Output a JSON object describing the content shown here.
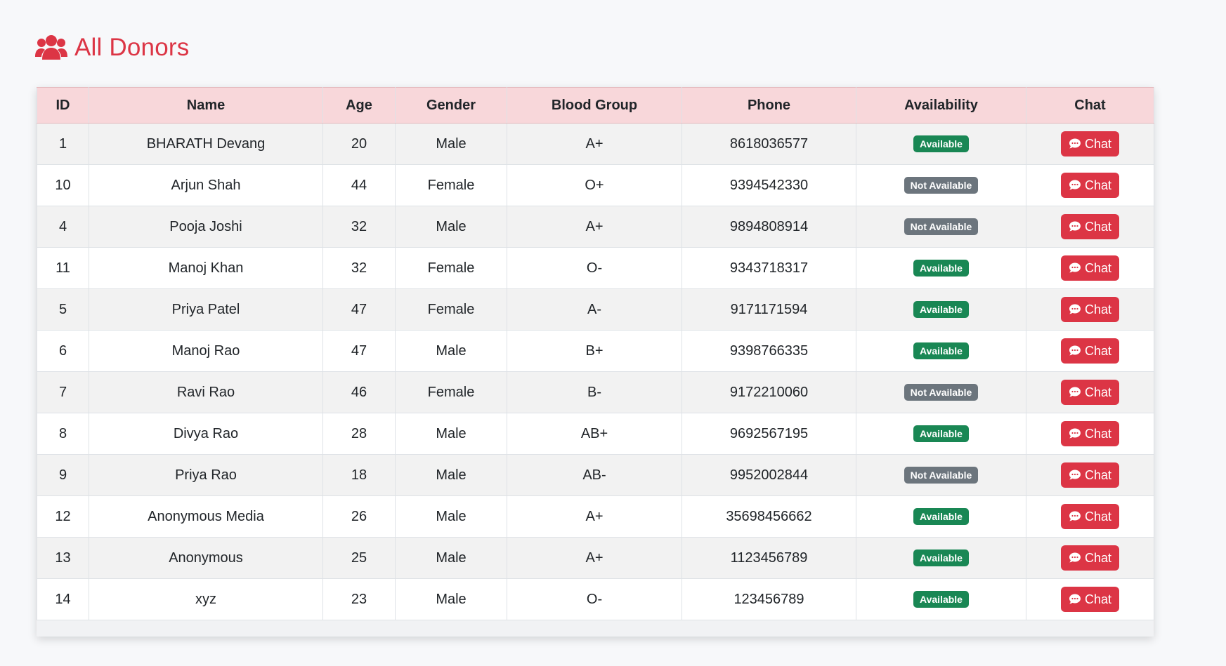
{
  "header": {
    "title": "All Donors",
    "icon": "users-icon",
    "accent_color": "#dc3545"
  },
  "table": {
    "columns": [
      "ID",
      "Name",
      "Age",
      "Gender",
      "Blood Group",
      "Phone",
      "Availability",
      "Chat"
    ],
    "rows": [
      {
        "id": "1",
        "name": "BHARATH Devang",
        "age": "20",
        "gender": "Male",
        "blood_group": "A+",
        "phone": "8618036577",
        "availability": "Available",
        "chat": "Chat"
      },
      {
        "id": "10",
        "name": "Arjun Shah",
        "age": "44",
        "gender": "Female",
        "blood_group": "O+",
        "phone": "9394542330",
        "availability": "Not Available",
        "chat": "Chat"
      },
      {
        "id": "4",
        "name": "Pooja Joshi",
        "age": "32",
        "gender": "Male",
        "blood_group": "A+",
        "phone": "9894808914",
        "availability": "Not Available",
        "chat": "Chat"
      },
      {
        "id": "11",
        "name": "Manoj Khan",
        "age": "32",
        "gender": "Female",
        "blood_group": "O-",
        "phone": "9343718317",
        "availability": "Available",
        "chat": "Chat"
      },
      {
        "id": "5",
        "name": "Priya Patel",
        "age": "47",
        "gender": "Female",
        "blood_group": "A-",
        "phone": "9171171594",
        "availability": "Available",
        "chat": "Chat"
      },
      {
        "id": "6",
        "name": "Manoj Rao",
        "age": "47",
        "gender": "Male",
        "blood_group": "B+",
        "phone": "9398766335",
        "availability": "Available",
        "chat": "Chat"
      },
      {
        "id": "7",
        "name": "Ravi Rao",
        "age": "46",
        "gender": "Female",
        "blood_group": "B-",
        "phone": "9172210060",
        "availability": "Not Available",
        "chat": "Chat"
      },
      {
        "id": "8",
        "name": "Divya Rao",
        "age": "28",
        "gender": "Male",
        "blood_group": "AB+",
        "phone": "9692567195",
        "availability": "Available",
        "chat": "Chat"
      },
      {
        "id": "9",
        "name": "Priya Rao",
        "age": "18",
        "gender": "Male",
        "blood_group": "AB-",
        "phone": "9952002844",
        "availability": "Not Available",
        "chat": "Chat"
      },
      {
        "id": "12",
        "name": "Anonymous Media",
        "age": "26",
        "gender": "Male",
        "blood_group": "A+",
        "phone": "35698456662",
        "availability": "Available",
        "chat": "Chat"
      },
      {
        "id": "13",
        "name": "Anonymous",
        "age": "25",
        "gender": "Male",
        "blood_group": "A+",
        "phone": "1123456789",
        "availability": "Available",
        "chat": "Chat"
      },
      {
        "id": "14",
        "name": "xyz",
        "age": "23",
        "gender": "Male",
        "blood_group": "O-",
        "phone": "123456789",
        "availability": "Available",
        "chat": "Chat"
      }
    ]
  },
  "colors": {
    "header_row": "#f8d7da",
    "available_badge": "#198754",
    "not_available_badge": "#6c757d",
    "chat_button": "#dc3545"
  }
}
